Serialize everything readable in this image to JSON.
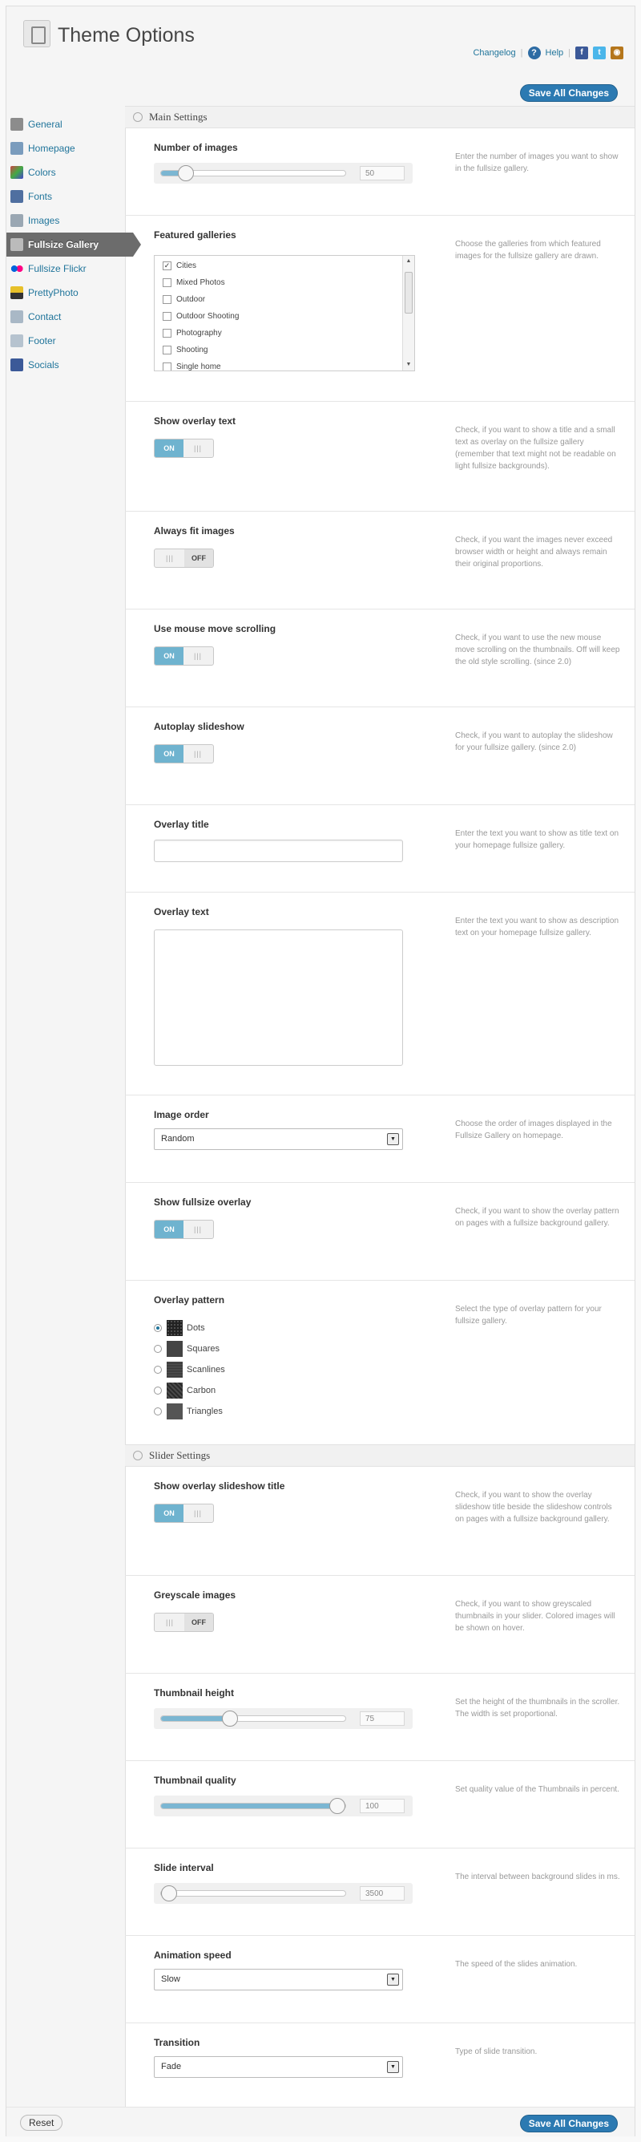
{
  "header": {
    "title": "Theme Options",
    "links": {
      "changelog": "Changelog",
      "help": "Help"
    },
    "icons": [
      "help-icon",
      "facebook-icon",
      "twitter-icon",
      "rss-icon"
    ]
  },
  "buttons": {
    "save": "Save All Changes",
    "reset": "Reset"
  },
  "sidebar": {
    "items": [
      {
        "label": "General",
        "icon": "wrench-icon"
      },
      {
        "label": "Homepage",
        "icon": "home-icon"
      },
      {
        "label": "Colors",
        "icon": "palette-icon"
      },
      {
        "label": "Fonts",
        "icon": "font-icon"
      },
      {
        "label": "Images",
        "icon": "image-icon"
      },
      {
        "label": "Fullsize Gallery",
        "icon": "gallery-icon",
        "active": true
      },
      {
        "label": "Fullsize Flickr",
        "icon": "flickr-icon"
      },
      {
        "label": "PrettyPhoto",
        "icon": "prettyphoto-icon"
      },
      {
        "label": "Contact",
        "icon": "contact-icon"
      },
      {
        "label": "Footer",
        "icon": "footer-icon"
      },
      {
        "label": "Socials",
        "icon": "facebook-icon"
      }
    ]
  },
  "main_settings": {
    "heading": "Main Settings",
    "number_of_images": {
      "title": "Number of images",
      "value": "50",
      "fraction": 0.1,
      "desc": "Enter the number of images you want to show in the fullsize gallery."
    },
    "featured_galleries": {
      "title": "Featured galleries",
      "desc": "Choose the galleries from which featured images for the fullsize gallery are drawn.",
      "items": [
        {
          "label": "Cities",
          "checked": true
        },
        {
          "label": "Mixed Photos",
          "checked": false
        },
        {
          "label": "Outdoor",
          "checked": false
        },
        {
          "label": "Outdoor Shooting",
          "checked": false
        },
        {
          "label": "Photography",
          "checked": false
        },
        {
          "label": "Shooting",
          "checked": false
        },
        {
          "label": "Single home",
          "checked": false
        }
      ]
    },
    "show_overlay_text": {
      "title": "Show overlay text",
      "state": "ON",
      "desc": "Check, if you want to show a title and a small text as overlay on the fullsize gallery (remember that text might not be readable on light fullsize backgrounds)."
    },
    "always_fit_images": {
      "title": "Always fit images",
      "state": "OFF",
      "desc": "Check, if you want the images never exceed browser width or height and always remain their original proportions."
    },
    "mouse_move_scrolling": {
      "title": "Use mouse move scrolling",
      "state": "ON",
      "desc": "Check, if you want to use the new mouse move scrolling on the thumbnails. Off will keep the old style scrolling. (since 2.0)"
    },
    "autoplay_slideshow": {
      "title": "Autoplay slideshow",
      "state": "ON",
      "desc": "Check, if you want to autoplay the slideshow for your fullsize gallery. (since 2.0)"
    },
    "overlay_title": {
      "title": "Overlay title",
      "value": "",
      "desc": "Enter the text you want to show as title text on your homepage fullsize gallery."
    },
    "overlay_text": {
      "title": "Overlay text",
      "value": "",
      "desc": "Enter the text you want to show as description text on your homepage fullsize gallery."
    },
    "image_order": {
      "title": "Image order",
      "value": "Random",
      "desc": "Choose the order of images displayed in the Fullsize Gallery on homepage."
    },
    "show_fullsize_overlay": {
      "title": "Show fullsize overlay",
      "state": "ON",
      "desc": "Check, if you want to show the overlay pattern on pages with a fullsize background gallery."
    },
    "overlay_pattern": {
      "title": "Overlay pattern",
      "desc": "Select the type of overlay pattern for your fullsize gallery.",
      "options": [
        {
          "label": "Dots",
          "selected": true
        },
        {
          "label": "Squares",
          "selected": false
        },
        {
          "label": "Scanlines",
          "selected": false
        },
        {
          "label": "Carbon",
          "selected": false
        },
        {
          "label": "Triangles",
          "selected": false
        }
      ]
    }
  },
  "slider_settings": {
    "heading": "Slider Settings",
    "show_overlay_slideshow_title": {
      "title": "Show overlay slideshow title",
      "state": "ON",
      "desc": "Check, if you want to show the overlay slideshow title beside the slideshow controls on pages with a fullsize background gallery."
    },
    "greyscale_images": {
      "title": "Greyscale images",
      "state": "OFF",
      "desc": "Check, if you want to show greyscaled thumbnails in your slider. Colored images will be shown on hover."
    },
    "thumbnail_height": {
      "title": "Thumbnail height",
      "value": "75",
      "fraction": 0.36,
      "desc": "Set the height of the thumbnails in the scroller. The width is set proportional."
    },
    "thumbnail_quality": {
      "title": "Thumbnail quality",
      "value": "100",
      "fraction": 1.0,
      "desc": "Set quality value of the Thumbnails in percent."
    },
    "slide_interval": {
      "title": "Slide interval",
      "value": "3500",
      "fraction": 0.0,
      "desc": "The interval between background slides in ms."
    },
    "animation_speed": {
      "title": "Animation speed",
      "value": "Slow",
      "desc": "The speed of the slides animation."
    },
    "transition": {
      "title": "Transition",
      "value": "Fade",
      "desc": "Type of slide transition."
    }
  },
  "colors": {
    "accent": "#2c7ab2",
    "toggle_on": "#6fb3cf",
    "link": "#21759b",
    "sidebar_active": "#6c6c6c"
  }
}
